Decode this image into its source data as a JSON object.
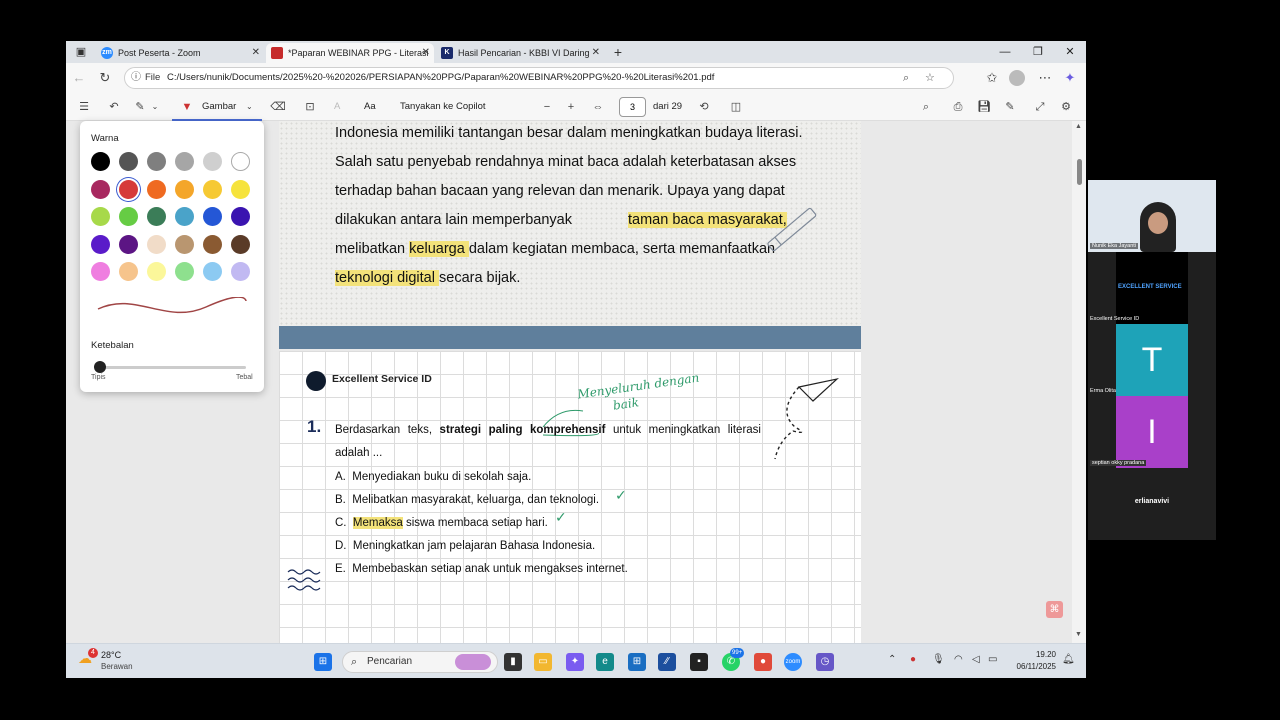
{
  "browser": {
    "tabs": [
      {
        "label": "Post Peserta - Zoom",
        "favicon": "zm",
        "active": false
      },
      {
        "label": "*Paparan WEBINAR PPG - Literasi",
        "favicon": "pdf",
        "active": true
      },
      {
        "label": "Hasil Pencarian - KBBI VI Daring",
        "favicon": "K",
        "active": false
      }
    ],
    "new_tab_glyph": "+",
    "address": {
      "scheme_label": "File",
      "url": "C:/Users/nunik/Documents/2025%20-%202026/PERSIAPAN%20PPG/Paparan%20WEBINAR%20PPG%20-%20Literasi%201.pdf"
    }
  },
  "pdf_toolbar": {
    "draw_label": "Gambar",
    "ai_label": "Aa",
    "copilot_label": "Tanyakan ke Copilot",
    "page_current": "3",
    "page_total_label": "dari 29"
  },
  "draw_panel": {
    "color_label": "Warna",
    "colors": [
      "#000000",
      "#555555",
      "#7f7f7f",
      "#a6a6a6",
      "#cfcfcf",
      "#ffffff",
      "#a8285f",
      "#d63a3a",
      "#ef6a21",
      "#f4a62a",
      "#f6c933",
      "#f6e33c",
      "#a7d94a",
      "#66cc44",
      "#3b7d58",
      "#4aa3c9",
      "#2457d6",
      "#3a14b0",
      "#5a1bc9",
      "#5c1584",
      "#f1dcc8",
      "#b99670",
      "#8a5a32",
      "#5a3b28",
      "#ef7ee0",
      "#f6c48c",
      "#fbf79a",
      "#8ee08e",
      "#8ccaf2",
      "#c1b9f2"
    ],
    "selected_color_index": 7,
    "thickness_label": "Ketebalan",
    "thin_label": "Tipis",
    "thick_label": "Tebal",
    "thickness_value": 0.0
  },
  "document": {
    "para_lines": {
      "l1": "Indonesia memiliki tantangan besar dalam meningkatkan budaya literasi.",
      "l2": "Salah satu penyebab rendahnya minat baca adalah keterbatasan akses",
      "l3": "terhadap bahan bacaan yang relevan dan menarik. Upaya yang dapat",
      "l4a": "dilakukan antara lain memperbanyak ",
      "l4b": "taman baca masyarakat,",
      "l5a": "melibatkan ",
      "l5b": "keluarga ",
      "l5c": "dalam kegiatan membaca, serta memanfaatkan",
      "l6a": "teknologi digital ",
      "l6b": "secara bijak."
    },
    "brand": "Excellent Service ID",
    "question_number": "1.",
    "question": {
      "pre": "Berdasarkan teks, ",
      "bold1": "strategi paling ",
      "bold2": "komprehensif",
      "post": " untuk meningkatkan literasi adalah ..."
    },
    "options": [
      {
        "letter": "A.",
        "text": "Menyediakan buku di sekolah saja."
      },
      {
        "letter": "B.",
        "text": "Melibatkan masyarakat, keluarga, dan teknologi."
      },
      {
        "letter": "C.",
        "highlight": "Memaksa",
        "text": " siswa membaca setiap hari."
      },
      {
        "letter": "D.",
        "text": "Meningkatkan jam pelajaran Bahasa Indonesia."
      },
      {
        "letter": "E.",
        "text": "Membebaskan setiap anak untuk mengakses internet."
      }
    ],
    "handwriting": {
      "line1": "Menyeluruh dengan",
      "line2": "baik"
    }
  },
  "taskbar": {
    "weather_temp": "28°C",
    "weather_desc": "Berawan",
    "weather_badge": "4",
    "search_label": "Pencarian",
    "whatsapp_badge": "99+",
    "time": "19.20",
    "date": "06/11/2025"
  },
  "zoom": {
    "participants": [
      {
        "name": "Nunik Eka Jayanti",
        "type": "video"
      },
      {
        "name": "Excellent Service ID",
        "type": "banner",
        "banner_text": "EXCELLENT SERVICE"
      },
      {
        "name": "Erma Olita",
        "letter": "T",
        "color": "#1ea3b8"
      },
      {
        "name": "septian okky pradana",
        "letter": "I",
        "color": "#a940c9"
      }
    ],
    "self_name": "erlianavivi"
  }
}
